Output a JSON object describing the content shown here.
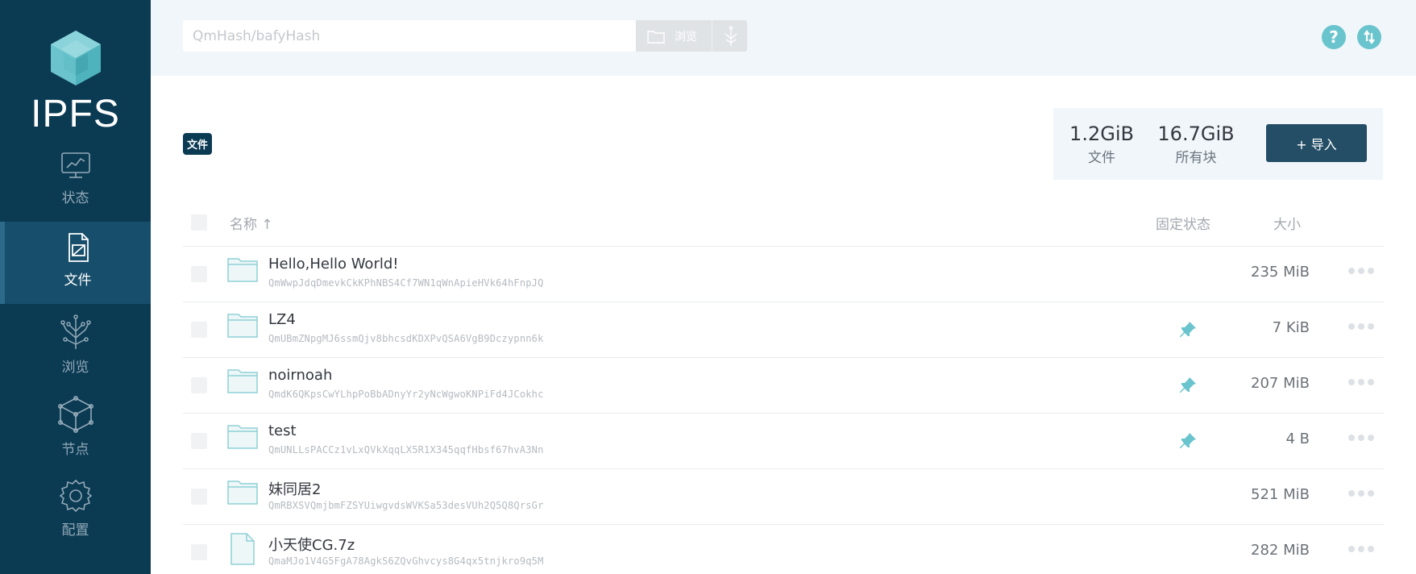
{
  "app": {
    "logo_text": "IPFS"
  },
  "sidebar": {
    "items": [
      {
        "label": "状态",
        "icon": "status-icon",
        "active": false
      },
      {
        "label": "文件",
        "icon": "files-icon",
        "active": true
      },
      {
        "label": "浏览",
        "icon": "explore-icon",
        "active": false
      },
      {
        "label": "节点",
        "icon": "peers-icon",
        "active": false
      },
      {
        "label": "配置",
        "icon": "settings-icon",
        "active": false
      }
    ]
  },
  "topbar": {
    "search_placeholder": "QmHash/bafyHash",
    "browse_label": "浏览",
    "help_icon": "help-icon",
    "connection_icon": "transfer-icon"
  },
  "files": {
    "badge": "文件",
    "stats": [
      {
        "value": "1.2GiB",
        "label": "文件"
      },
      {
        "value": "16.7GiB",
        "label": "所有块"
      }
    ],
    "import_label": "+ 导入"
  },
  "table": {
    "headers": {
      "name": "名称 ↑",
      "pin": "固定状态",
      "size": "大小"
    },
    "rows": [
      {
        "name": "Hello,Hello World!",
        "cid": "QmWwpJdqDmevkCkKPhNBS4Cf7WN1qWnApieHVk64hFnpJQ",
        "size": "235 MiB",
        "type": "folder",
        "pinned": false
      },
      {
        "name": "LZ4",
        "cid": "QmUBmZNpgMJ6ssmQjv8bhcsdKDXPvQSA6VgB9Dczypnn6k",
        "size": "7 KiB",
        "type": "folder",
        "pinned": true
      },
      {
        "name": "noirnoah",
        "cid": "QmdK6QKpsCwYLhpPoBbADnyYr2yNcWgwoKNPiFd4JCokhc",
        "size": "207 MiB",
        "type": "folder",
        "pinned": true
      },
      {
        "name": "test",
        "cid": "QmUNLLsPACCz1vLxQVkXqqLX5R1X345qqfHbsf67hvA3Nn",
        "size": "4 B",
        "type": "folder",
        "pinned": true
      },
      {
        "name": "妹同居2",
        "cid": "QmRBXSVQmjbmFZSYUiwgvdsWVKSa53desVUh2Q5Q8QrsGr",
        "size": "521 MiB",
        "type": "folder",
        "pinned": false
      },
      {
        "name": "小天使CG.7z",
        "cid": "QmaMJo1V4G5FgA78AgkS6ZQvGhvcys8G4qx5tnjkro9q5M",
        "size": "282 MiB",
        "type": "file",
        "pinned": false
      }
    ]
  },
  "colors": {
    "sidebar_bg": "#0b3a53",
    "accent": "#69c4cd",
    "import_bg": "#244e66"
  }
}
